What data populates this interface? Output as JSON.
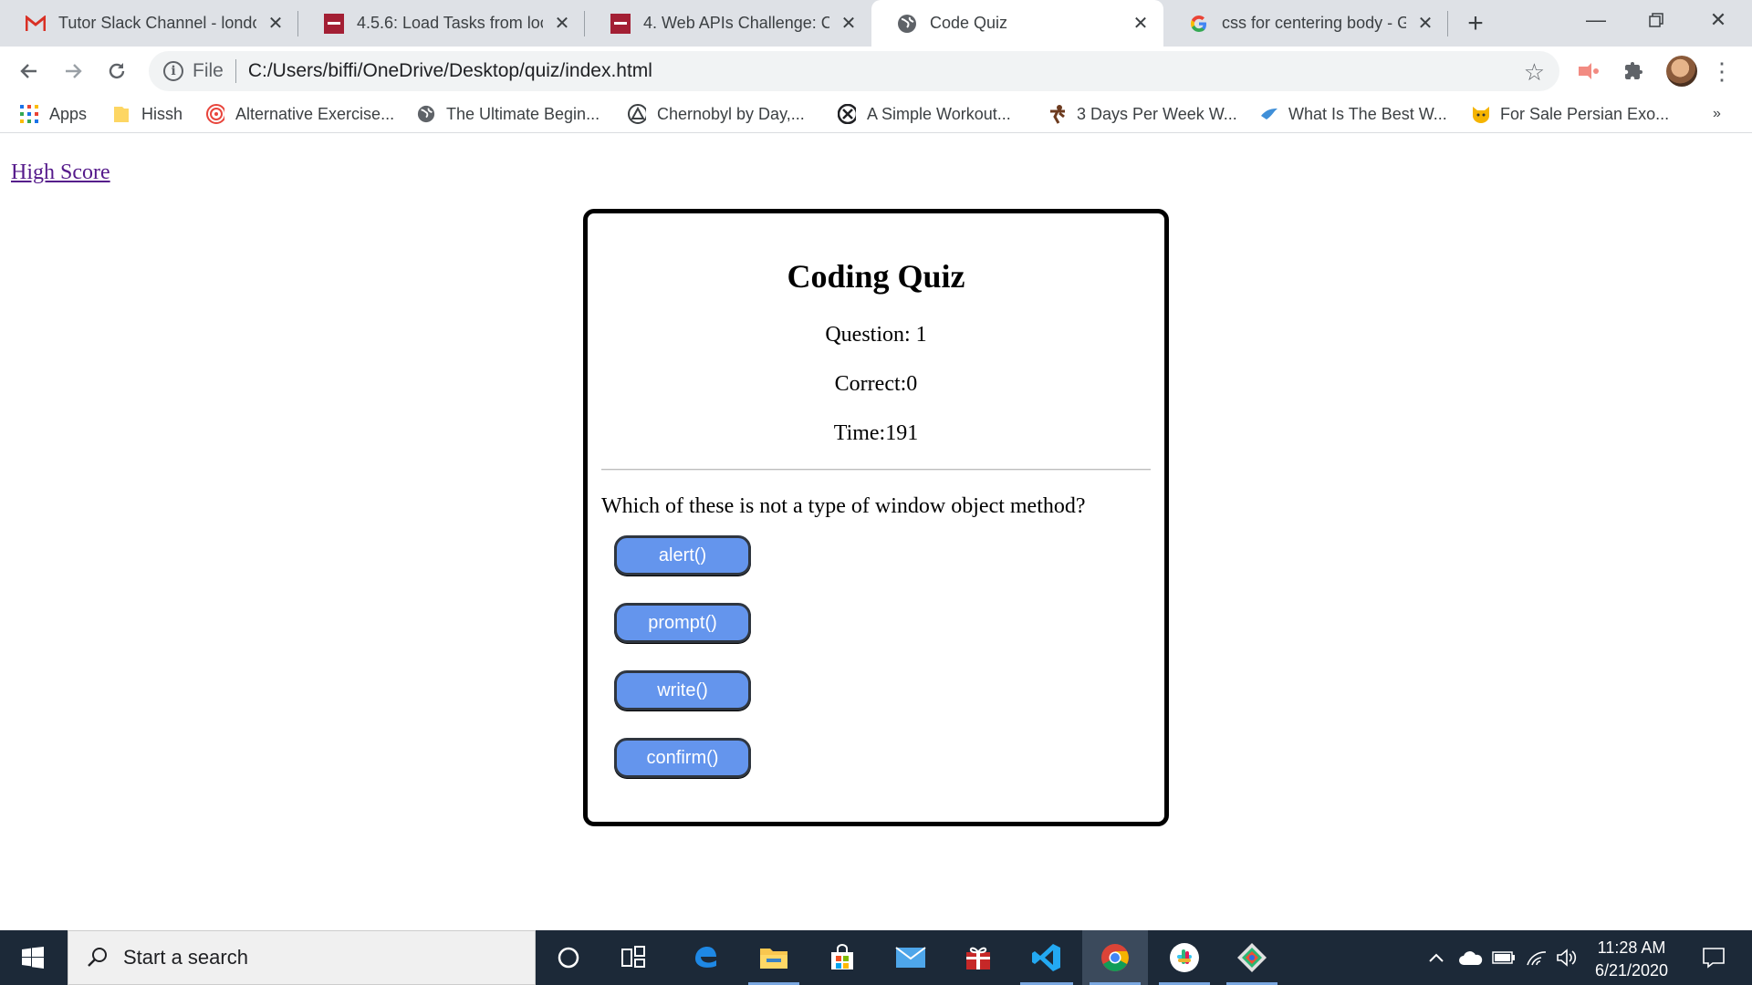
{
  "tabs": [
    {
      "title": "Tutor Slack Channel - londo",
      "favicon": "gmail-icon"
    },
    {
      "title": "4.5.6: Load Tasks from local",
      "favicon": "bootcamp-icon"
    },
    {
      "title": "4. Web APIs Challenge: Cod",
      "favicon": "bootcamp-icon"
    },
    {
      "title": "Code Quiz",
      "favicon": "globe-icon",
      "active": true
    },
    {
      "title": "css for centering body - Go",
      "favicon": "google-icon"
    }
  ],
  "address": {
    "scheme": "File",
    "url": "C:/Users/biffi/OneDrive/Desktop/quiz/index.html"
  },
  "bookmarks": [
    {
      "label": "Apps",
      "icon": "apps-grid-icon"
    },
    {
      "label": "Hissh",
      "icon": "folder-icon"
    },
    {
      "label": "Alternative Exercise...",
      "icon": "target-icon"
    },
    {
      "label": "The Ultimate Begin...",
      "icon": "globe-icon"
    },
    {
      "label": "Chernobyl by Day,...",
      "icon": "triangle-icon"
    },
    {
      "label": "A Simple Workout...",
      "icon": "x-circle-icon"
    },
    {
      "label": "3 Days Per Week W...",
      "icon": "lifter-icon"
    },
    {
      "label": "What Is The Best W...",
      "icon": "bird-icon"
    },
    {
      "label": "For Sale Persian Exo...",
      "icon": "cat-icon"
    }
  ],
  "bookmarks_more": "»",
  "page": {
    "high_score_link": "High Score",
    "quiz": {
      "title": "Coding Quiz",
      "question_label": "Question: 1",
      "correct_label": "Correct:0",
      "time_label": "Time:191",
      "question_text": "Which of these is not a type of window object method?",
      "answers": [
        "alert()",
        "prompt()",
        "write()",
        "confirm()"
      ]
    }
  },
  "taskbar": {
    "search_placeholder": "Start a search",
    "time": "11:28 AM",
    "date": "6/21/2020"
  },
  "colors": {
    "answer_button": "#6495ed",
    "visited_link": "#551a8b",
    "taskbar": "#1c2938"
  }
}
